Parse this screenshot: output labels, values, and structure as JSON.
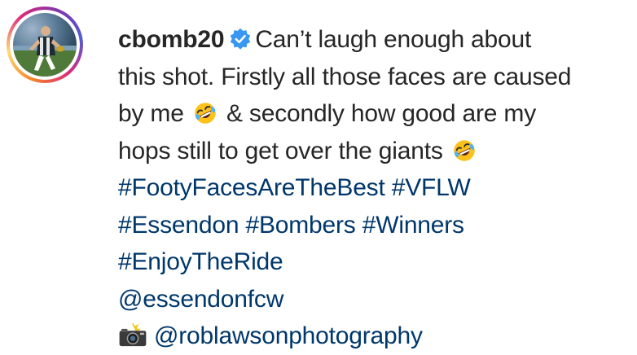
{
  "post": {
    "username": "cbomb20",
    "verified_icon": "verified-badge-icon",
    "caption": {
      "line1": "Can’t laugh enough about",
      "line2": "this shot. Firstly all those faces are caused",
      "line3a": "by me",
      "line3b": "& secondly how good are my",
      "line4": "hops still to get over the giants",
      "hashtags_line1": [
        "#FootyFacesAreTheBest",
        "#VFLW"
      ],
      "hashtags_line2": [
        "#Essendon",
        "#Bombers",
        "#Winners"
      ],
      "hashtags_line3": [
        "#EnjoyTheRide"
      ],
      "mention": "@essendonfcw",
      "photo_credit": "@roblawsonphotography"
    },
    "emoji_icons": [
      "rolling-on-floor-laughing-emoji",
      "camera-with-flash-emoji"
    ],
    "colors": {
      "text": "#262626",
      "link": "#00376b",
      "verified": "#3897f0"
    }
  }
}
